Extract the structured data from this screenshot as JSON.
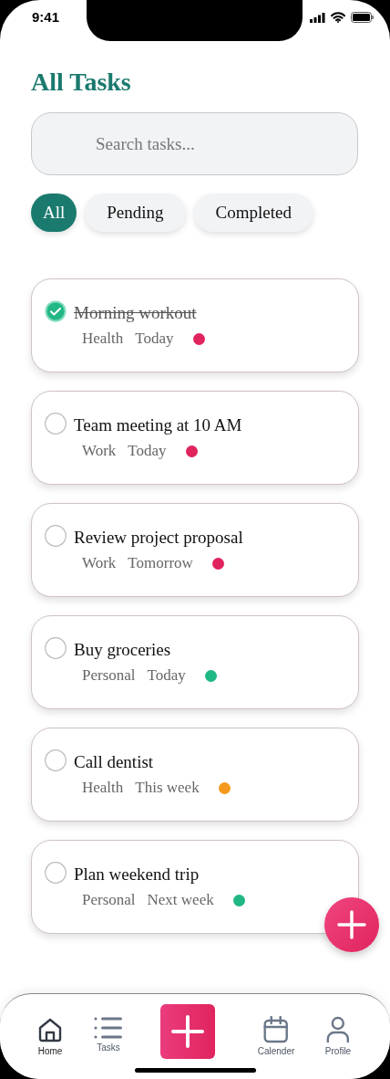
{
  "status_bar": {
    "time": "9:41"
  },
  "title": "All Tasks",
  "search": {
    "placeholder": "Search tasks..."
  },
  "filters": [
    {
      "label": "All",
      "selected": true
    },
    {
      "label": "Pending",
      "selected": false
    },
    {
      "label": "Completed",
      "selected": false
    }
  ],
  "tasks": [
    {
      "title": "Morning workout",
      "done": true,
      "category": "Health",
      "due": "Today",
      "color": "#e0245e"
    },
    {
      "title": "Team meeting at 10 AM",
      "done": false,
      "category": "Work",
      "due": "Today",
      "color": "#e0245e"
    },
    {
      "title": "Review project proposal",
      "done": false,
      "category": "Work",
      "due": "Tomorrow",
      "color": "#e0245e"
    },
    {
      "title": "Buy groceries",
      "done": false,
      "category": "Personal",
      "due": "Today",
      "color": "#1fb783"
    },
    {
      "title": "Call dentist",
      "done": false,
      "category": "Health",
      "due": "This week",
      "color": "#f39a1e"
    },
    {
      "title": "Plan weekend trip",
      "done": false,
      "category": "Personal",
      "due": "Next week",
      "color": "#1fb783"
    }
  ],
  "bottom_nav": [
    {
      "label": "Home",
      "selected": true
    },
    {
      "label": "Tasks",
      "selected": false
    },
    {
      "label": "Calender",
      "selected": false
    },
    {
      "label": "Profile",
      "selected": false
    }
  ]
}
